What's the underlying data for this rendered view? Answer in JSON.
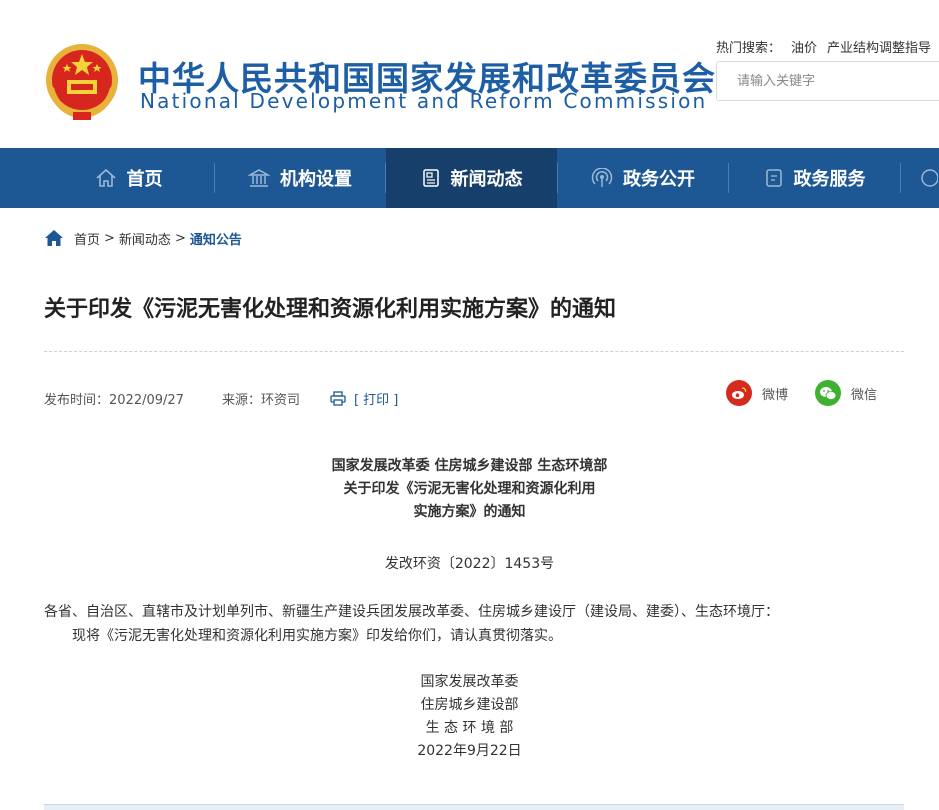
{
  "header": {
    "title_cn": "中华人民共和国国家发展和改革委员会",
    "title_en": "National Development and Reform Commission",
    "hot_search_label": "热门搜索：",
    "hot_search_items": [
      "油价",
      "产业结构调整指导"
    ],
    "search_placeholder": "请输入关键字"
  },
  "nav": {
    "items": [
      {
        "label": "首页",
        "icon": "home-icon"
      },
      {
        "label": "机构设置",
        "icon": "institution-icon"
      },
      {
        "label": "新闻动态",
        "icon": "news-icon",
        "active": true
      },
      {
        "label": "政务公开",
        "icon": "broadcast-icon"
      },
      {
        "label": "政务服务",
        "icon": "document-icon"
      }
    ]
  },
  "breadcrumb": {
    "items": [
      "首页",
      "新闻动态",
      "通知公告"
    ],
    "separator": ">"
  },
  "article": {
    "title": "关于印发《污泥无害化处理和资源化利用实施方案》的通知",
    "publish_time": "发布时间：2022/09/27",
    "source": "来源：环资司",
    "print_label": "[ 打印 ]",
    "share": [
      {
        "label": "微博",
        "icon": "weibo-icon",
        "color": "#d52b1e"
      },
      {
        "label": "微信",
        "icon": "wechat-icon",
        "color": "#3fb131"
      }
    ],
    "doc_head": [
      "国家发展改革委 住房城乡建设部 生态环境部",
      "关于印发《污泥无害化处理和资源化利用",
      "实施方案》的通知"
    ],
    "doc_number": "发改环资〔2022〕1453号",
    "recipients": "各省、自治区、直辖市及计划单列市、新疆生产建设兵团发展改革委、住房城乡建设厅（建设局、建委）、生态环境厅：",
    "body": "现将《污泥无害化处理和资源化利用实施方案》印发给你们，请认真贯彻落实。",
    "signatures": [
      "国家发展改革委",
      "住房城乡建设部",
      "生 态 环 境 部",
      "2022年9月22日"
    ]
  },
  "colors": {
    "brand_blue": "#1d5895",
    "nav_active": "#163f6c",
    "title_blue": "#1d5ea5"
  }
}
